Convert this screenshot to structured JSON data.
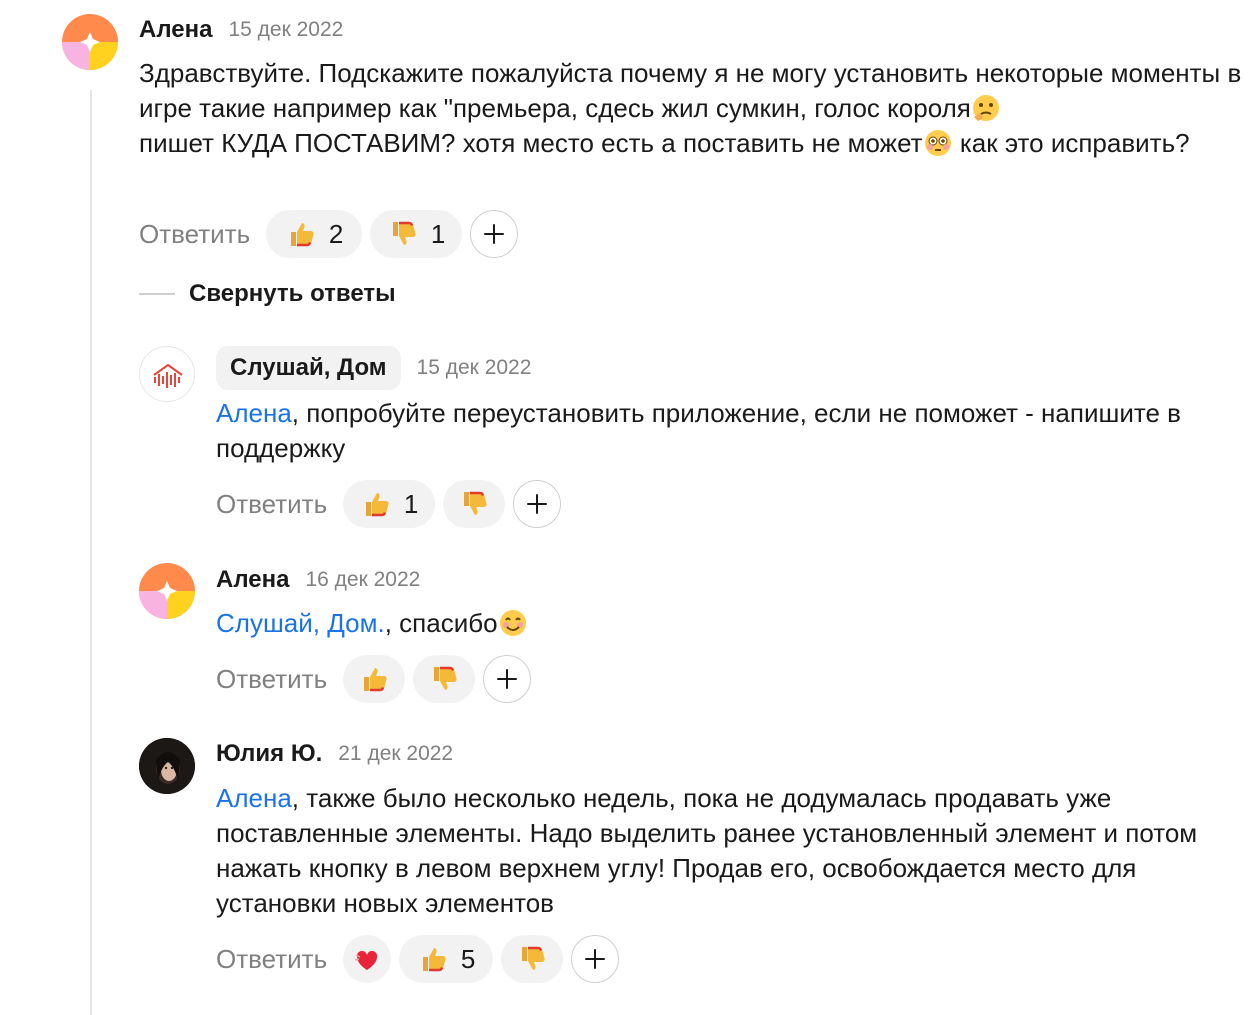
{
  "comments": [
    {
      "author": "Алена",
      "date": "15 дек 2022",
      "avatar_icon": "orange-pink-yellow-avatar",
      "text": "Здравствуйте. Подскажите пожалуйста почему я не могу установить некоторые моменты в игре такие например как \"премьера, сдесь жил сумкин, голос короля",
      "text_mid": " пишет КУДА ПОСТАВИМ? хотя место есть а поставить не может",
      "text_end": "  как это исправить?",
      "emojis": [
        "thinking-face",
        "flushed-face"
      ],
      "reply_label": "Ответить",
      "likes": "2",
      "dislikes": "1"
    },
    {
      "author": "Слушай, Дом",
      "date": "15 дек 2022",
      "avatar_icon": "house-soundwave-logo",
      "mention": "Алена",
      "text": ", попробуйте переустановить приложение, если не поможет - напишите в поддержку",
      "reply_label": "Ответить",
      "likes": "1",
      "dislikes": ""
    },
    {
      "author": "Алена",
      "date": "16 дек 2022",
      "avatar_icon": "orange-pink-yellow-avatar",
      "mention": "Слушай, Дом.",
      "text": ", спасибо",
      "emojis": [
        "smiling-face"
      ],
      "reply_label": "Ответить",
      "likes": "",
      "dislikes": ""
    },
    {
      "author": "Юлия Ю.",
      "date": "21 дек 2022",
      "avatar_icon": "user-photo-avatar",
      "mention": "Алена",
      "text": ", также было несколько недель, пока не додумалась продавать уже поставленные элементы. Надо выделить ранее установленный элемент и потом нажать кнопку в левом верхнем углу! Продав его, освобождается место для установки новых элементов",
      "reply_label": "Ответить",
      "heart_reaction": "",
      "likes": "5",
      "dislikes": ""
    }
  ],
  "collapse_label": "Свернуть ответы",
  "colors": {
    "mention": "#1a73e8",
    "muted": "#808080",
    "pill": "#f2f2f2"
  }
}
